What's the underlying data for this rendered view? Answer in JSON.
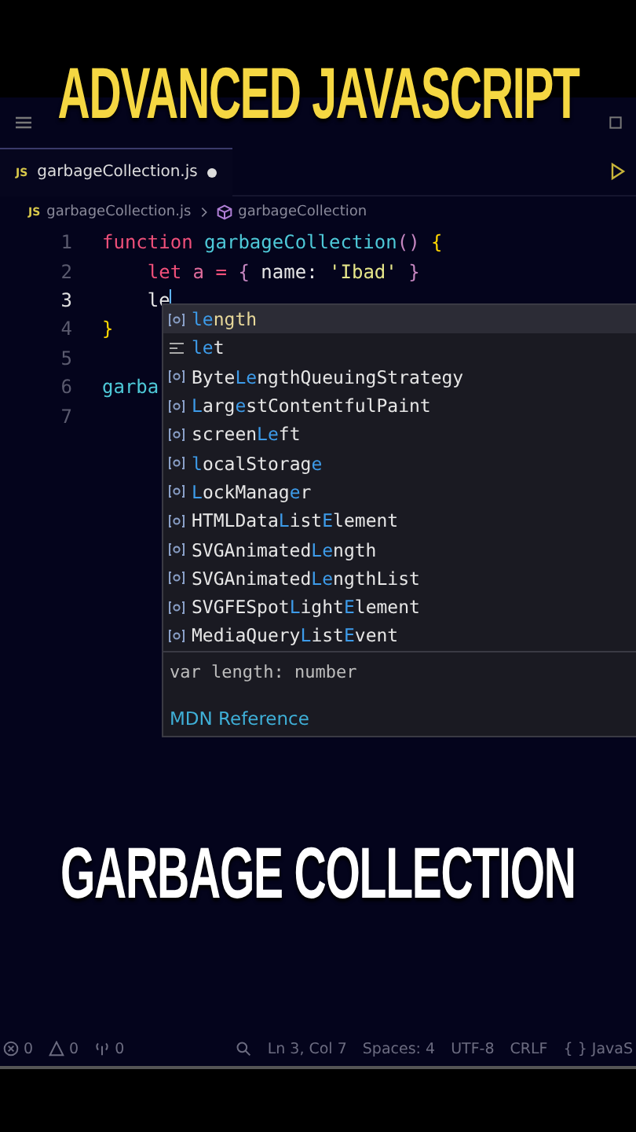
{
  "caption_top": "ADVANCED JAVASCRIPT",
  "tab": {
    "label": "garbageCollection.js",
    "badge": "JS",
    "dirty": true
  },
  "breadcrumb": {
    "file": "garbageCollection.js",
    "badge": "JS",
    "symbol": "garbageCollection"
  },
  "code_lines": [
    {
      "number": "1",
      "current": false,
      "tokens": [
        {
          "text": "function ",
          "kind": "keyword"
        },
        {
          "text": "garbageCollection",
          "kind": "func"
        },
        {
          "text": "() ",
          "kind": "punct"
        },
        {
          "text": "{",
          "kind": "brace"
        }
      ]
    },
    {
      "number": "2",
      "current": false,
      "tokens": [
        {
          "text": "    let ",
          "kind": "keyword"
        },
        {
          "text": "a ",
          "kind": "var"
        },
        {
          "text": "= ",
          "kind": "keyword"
        },
        {
          "text": "{ ",
          "kind": "punct"
        },
        {
          "text": "name",
          "kind": "plain"
        },
        {
          "text": ": ",
          "kind": "plain"
        },
        {
          "text": "'Ibad'",
          "kind": "string"
        },
        {
          "text": " }",
          "kind": "punct"
        }
      ]
    },
    {
      "number": "3",
      "current": true,
      "tokens": [
        {
          "text": "    le",
          "kind": "plain"
        }
      ]
    },
    {
      "number": "4",
      "current": false,
      "tokens": [
        {
          "text": "}",
          "kind": "brace"
        }
      ]
    },
    {
      "number": "5",
      "current": false
    },
    {
      "number": "6",
      "current": false,
      "tokens": [
        {
          "text": "garba",
          "kind": "func"
        }
      ]
    },
    {
      "number": "7",
      "current": false
    }
  ],
  "suggestions": [
    {
      "kind": "variable",
      "selected": true,
      "parts": [
        {
          "text": "le",
          "match": true
        },
        {
          "text": "ngth",
          "match": false
        }
      ]
    },
    {
      "kind": "keyword",
      "selected": false,
      "parts": [
        {
          "text": "le",
          "match": true
        },
        {
          "text": "t",
          "match": false
        }
      ]
    },
    {
      "kind": "variable",
      "selected": false,
      "parts": [
        {
          "text": "Byte",
          "match": false
        },
        {
          "text": "Le",
          "match": true
        },
        {
          "text": "ngthQueuingStrategy",
          "match": false
        }
      ]
    },
    {
      "kind": "variable",
      "selected": false,
      "parts": [
        {
          "text": "L",
          "match": true
        },
        {
          "text": "arg",
          "match": false
        },
        {
          "text": "e",
          "match": true
        },
        {
          "text": "stContentfulPaint",
          "match": false
        }
      ]
    },
    {
      "kind": "variable",
      "selected": false,
      "parts": [
        {
          "text": "screen",
          "match": false
        },
        {
          "text": "Le",
          "match": true
        },
        {
          "text": "ft",
          "match": false
        }
      ]
    },
    {
      "kind": "variable",
      "selected": false,
      "parts": [
        {
          "text": "l",
          "match": true
        },
        {
          "text": "ocalStorag",
          "match": false
        },
        {
          "text": "e",
          "match": true
        }
      ]
    },
    {
      "kind": "variable",
      "selected": false,
      "parts": [
        {
          "text": "L",
          "match": true
        },
        {
          "text": "ockManag",
          "match": false
        },
        {
          "text": "e",
          "match": true
        },
        {
          "text": "r",
          "match": false
        }
      ]
    },
    {
      "kind": "variable",
      "selected": false,
      "parts": [
        {
          "text": "HTMLData",
          "match": false
        },
        {
          "text": "L",
          "match": true
        },
        {
          "text": "ist",
          "match": false
        },
        {
          "text": "E",
          "match": true
        },
        {
          "text": "lement",
          "match": false
        }
      ]
    },
    {
      "kind": "variable",
      "selected": false,
      "parts": [
        {
          "text": "SVGAnimated",
          "match": false
        },
        {
          "text": "Le",
          "match": true
        },
        {
          "text": "ngth",
          "match": false
        }
      ]
    },
    {
      "kind": "variable",
      "selected": false,
      "parts": [
        {
          "text": "SVGAnimated",
          "match": false
        },
        {
          "text": "Le",
          "match": true
        },
        {
          "text": "ngthList",
          "match": false
        }
      ]
    },
    {
      "kind": "variable",
      "selected": false,
      "parts": [
        {
          "text": "SVGFESpot",
          "match": false
        },
        {
          "text": "L",
          "match": true
        },
        {
          "text": "ight",
          "match": false
        },
        {
          "text": "E",
          "match": true
        },
        {
          "text": "lement",
          "match": false
        }
      ]
    },
    {
      "kind": "variable",
      "selected": false,
      "parts": [
        {
          "text": "MediaQuery",
          "match": false
        },
        {
          "text": "L",
          "match": true
        },
        {
          "text": "ist",
          "match": false
        },
        {
          "text": "E",
          "match": true
        },
        {
          "text": "vent",
          "match": false
        }
      ]
    }
  ],
  "details": {
    "signature": "var length: number",
    "link": "MDN Reference"
  },
  "caption_bottom": "GARBAGE COLLECTION",
  "status_bar": {
    "errors": "0",
    "warnings": "0",
    "ports": "0",
    "position": "Ln 3, Col 7",
    "spaces": "Spaces: 4",
    "encoding": "UTF-8",
    "eol": "CRLF",
    "language": "{ } JavaS"
  }
}
